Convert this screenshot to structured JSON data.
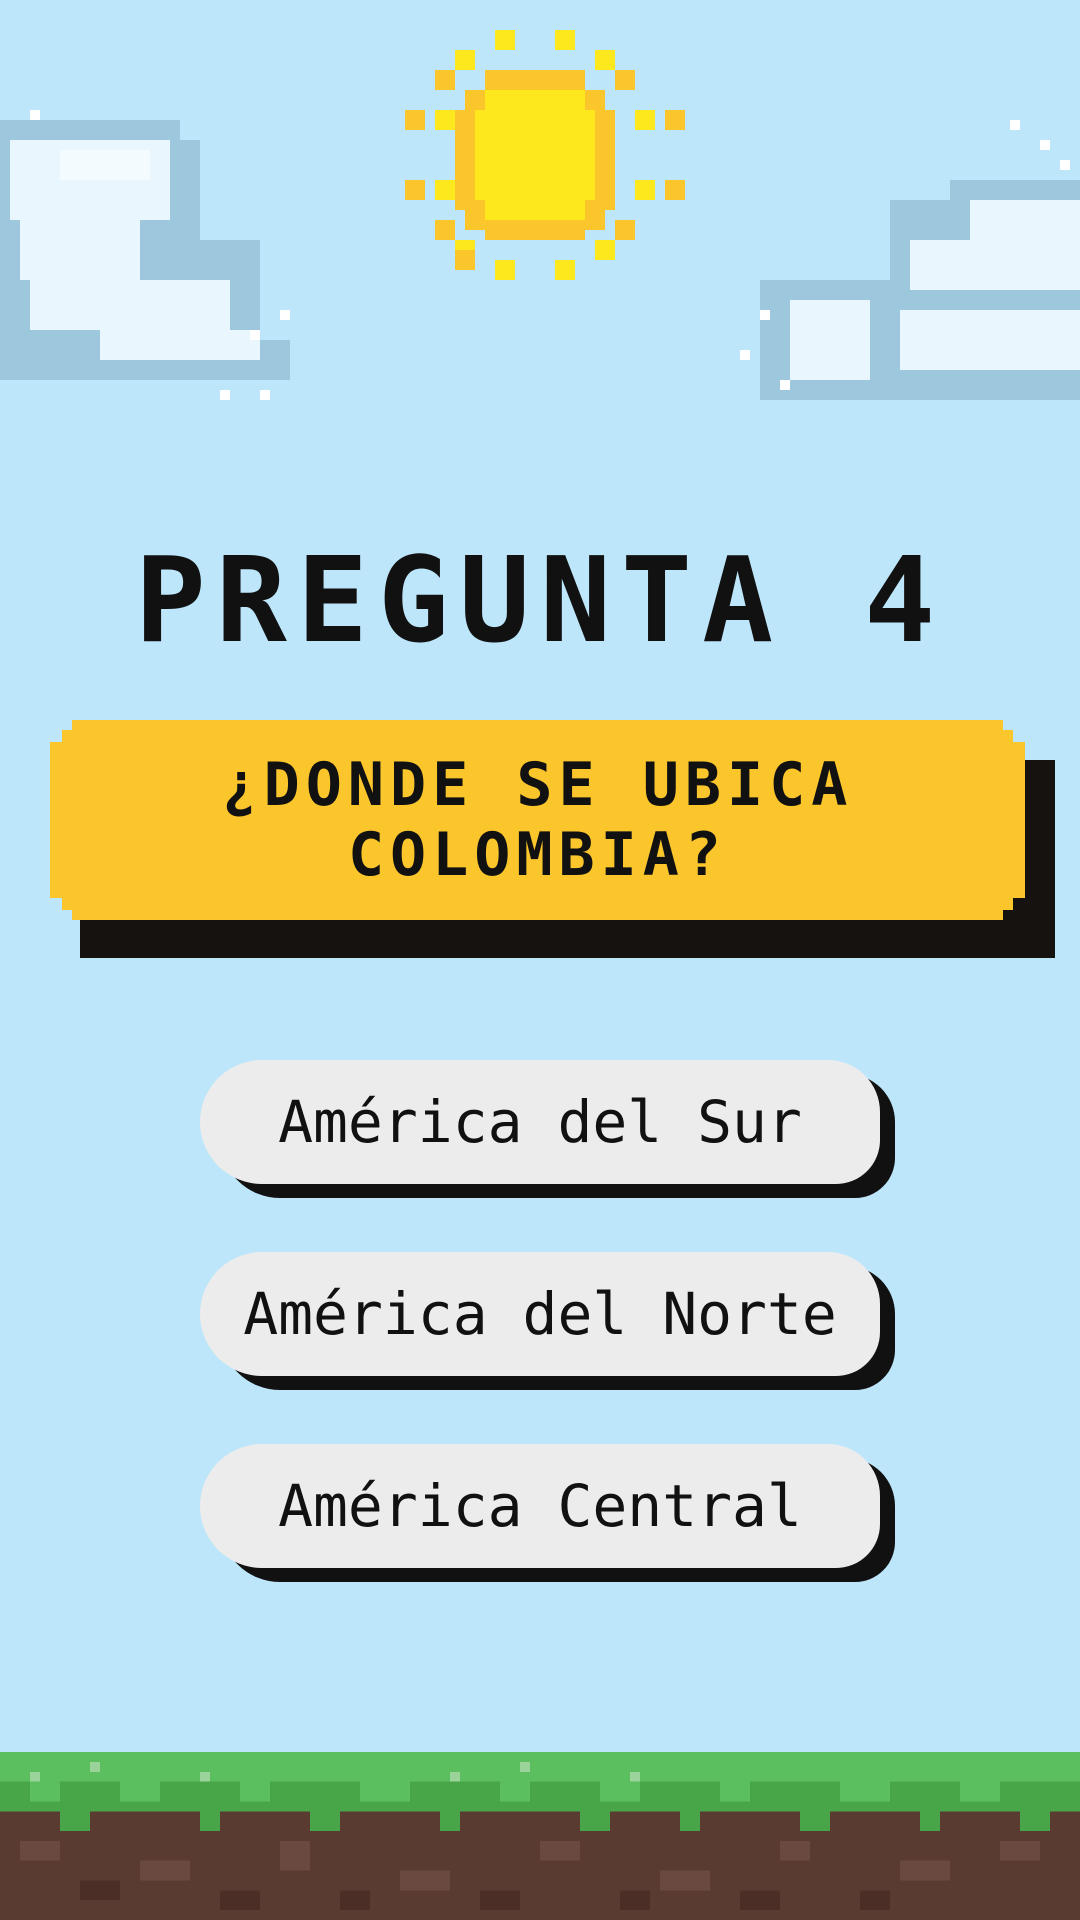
{
  "title": "PREGUNTA 4",
  "question": "¿DONDE SE UBICA\nCOLOMBIA?",
  "answers": [
    {
      "label": "América del Sur"
    },
    {
      "label": "América del Norte"
    },
    {
      "label": "América Central"
    }
  ],
  "colors": {
    "sky": "#bde6fb",
    "sun": "#fde81e",
    "sun_outline": "#fbc62b",
    "question_box": "#fbc62b",
    "answer_button": "#ececec",
    "grass": "#5cbf5f",
    "dirt": "#5a3b32"
  },
  "icons": [
    "sun-icon",
    "cloud-icon",
    "sparkle-icon",
    "grass-ground"
  ]
}
